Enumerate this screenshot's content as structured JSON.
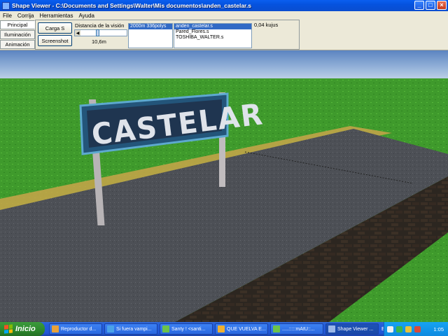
{
  "window": {
    "title": "Shape Viewer - C:\\Documents and Settings\\Walter\\Mis documentos\\anden_castelar.s",
    "controls": [
      "_",
      "□",
      "×"
    ]
  },
  "menu": [
    "File",
    "Corrija",
    "Herramientas",
    "Ayuda"
  ],
  "tabs": [
    {
      "label": "Principal",
      "active": true
    },
    {
      "label": "Iluminación",
      "active": false
    },
    {
      "label": "Animación",
      "active": false
    }
  ],
  "panel": {
    "load_button": "Carga S",
    "screenshot_button": "Screenshot",
    "distance_label": "Distancia de la visión",
    "distance_value": "10,6m",
    "distance_slider_fraction": 0.35,
    "lod_items": [
      {
        "text": "2000m 336polys",
        "selected": true
      }
    ],
    "file_items": [
      {
        "text": "anden_castelar.s",
        "selected": true
      },
      {
        "text": "Pared_Flores.s",
        "selected": false
      },
      {
        "text": "TOSHIBA_WALTER.s",
        "selected": false
      }
    ],
    "coords": "0,04 kujus"
  },
  "scene": {
    "sign_text": "CASTELAR"
  },
  "taskbar": {
    "start_label": "Inicio",
    "tasks": [
      {
        "label": "Reproductor d...",
        "icon_color": "#e8a13a",
        "active": false
      },
      {
        "label": "Si fuera vampi...",
        "icon_color": "#4aa2e8",
        "active": false
      },
      {
        "label": "Santy ! <santi...",
        "icon_color": "#6cc24a",
        "active": false
      },
      {
        "label": "QUE VUELVA E...",
        "icon_color": "#f0b030",
        "active": false
      },
      {
        "label": ".....:::::mAtU::...",
        "icon_color": "#6cc24a",
        "active": false
      },
      {
        "label": "Shape Viewer ...",
        "icon_color": "#9ab7e8",
        "active": true
      }
    ],
    "language": "ES",
    "clock": "1:05"
  }
}
